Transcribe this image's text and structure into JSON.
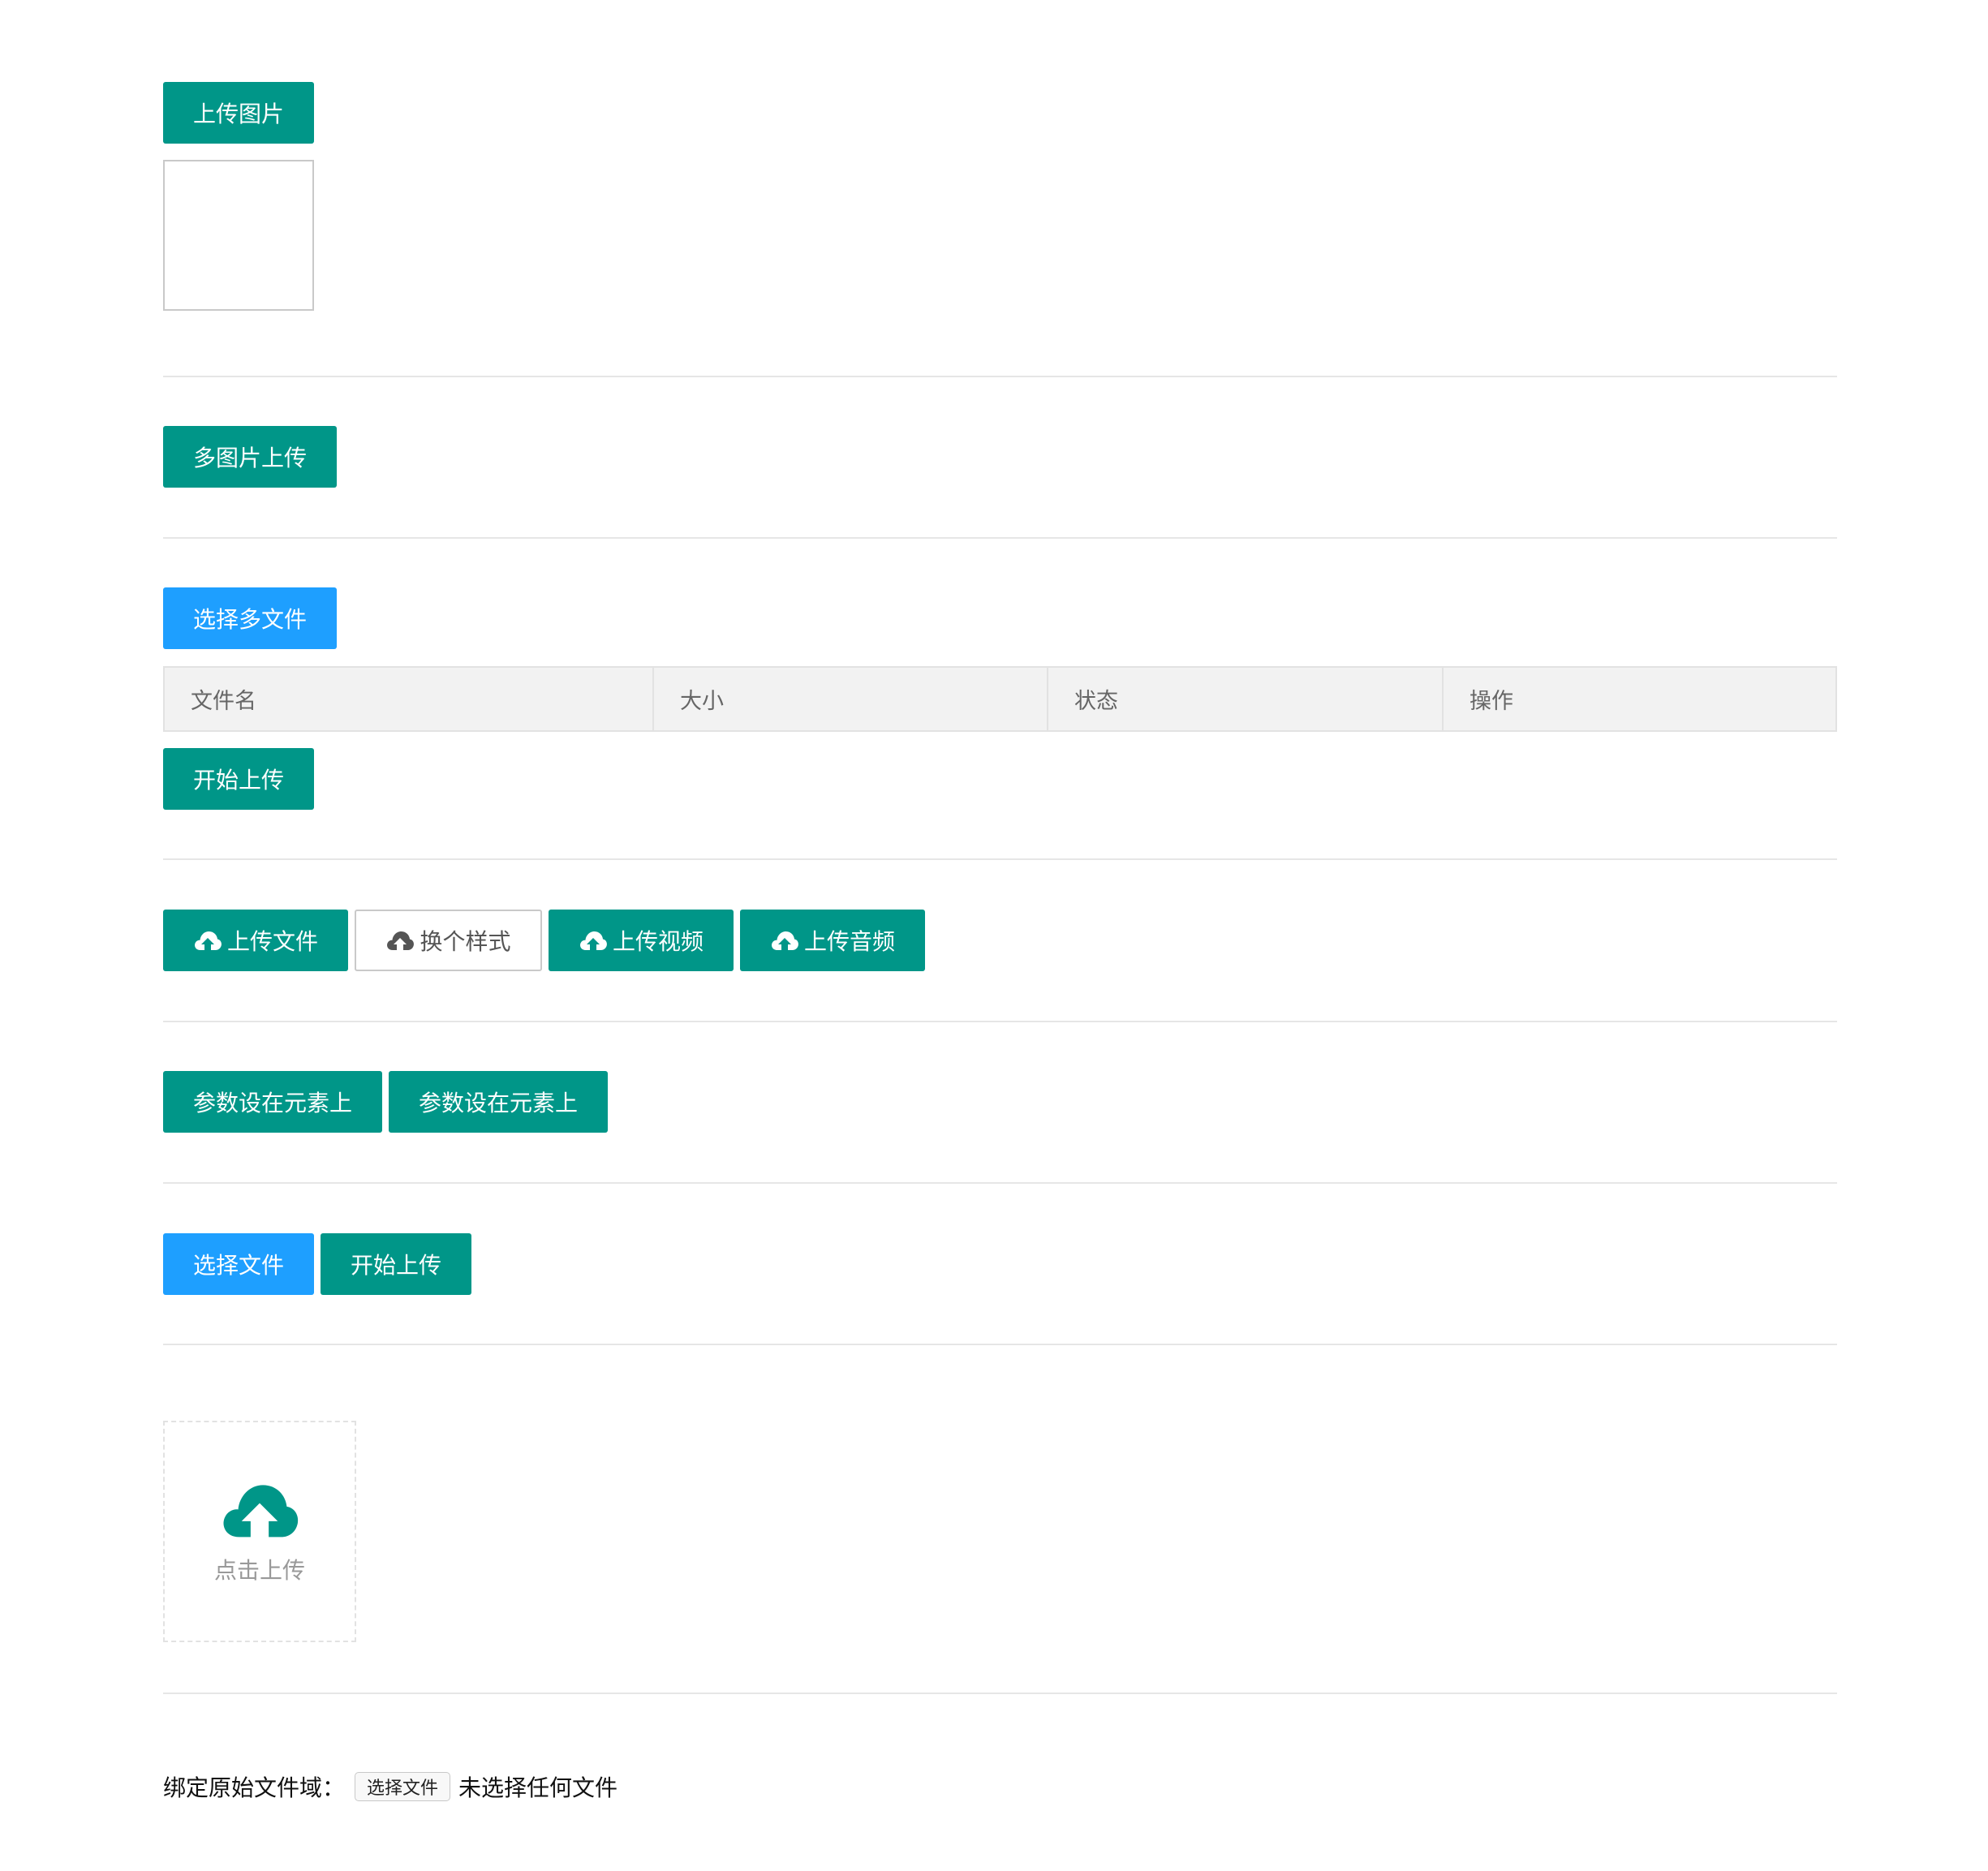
{
  "colors": {
    "primary": "#009688",
    "normal": "#1e9fff",
    "divider": "#e6e6e6",
    "table_header_bg": "#f2f2f2",
    "muted_text": "#999999"
  },
  "section1": {
    "upload_image_label": "上传图片"
  },
  "section2": {
    "multi_image_label": "多图片上传"
  },
  "section3": {
    "select_files_label": "选择多文件",
    "table_headers": [
      "文件名",
      "大小",
      "状态",
      "操作"
    ],
    "start_upload_label": "开始上传"
  },
  "section4": {
    "buttons": [
      {
        "label": "上传文件",
        "icon": "cloud-upload-icon"
      },
      {
        "label": "换个样式",
        "icon": "cloud-upload-icon"
      },
      {
        "label": "上传视频",
        "icon": "cloud-upload-icon"
      },
      {
        "label": "上传音频",
        "icon": "cloud-upload-icon"
      }
    ]
  },
  "section5": {
    "buttons": [
      "参数设在元素上",
      "参数设在元素上"
    ]
  },
  "section6": {
    "select_file_label": "选择文件",
    "start_upload_label": "开始上传"
  },
  "section7": {
    "icon": "cloud-upload-icon",
    "drop_text": "点击上传"
  },
  "section8": {
    "label": "绑定原始文件域：",
    "choose_button": "选择文件",
    "status_text": "未选择任何文件"
  }
}
